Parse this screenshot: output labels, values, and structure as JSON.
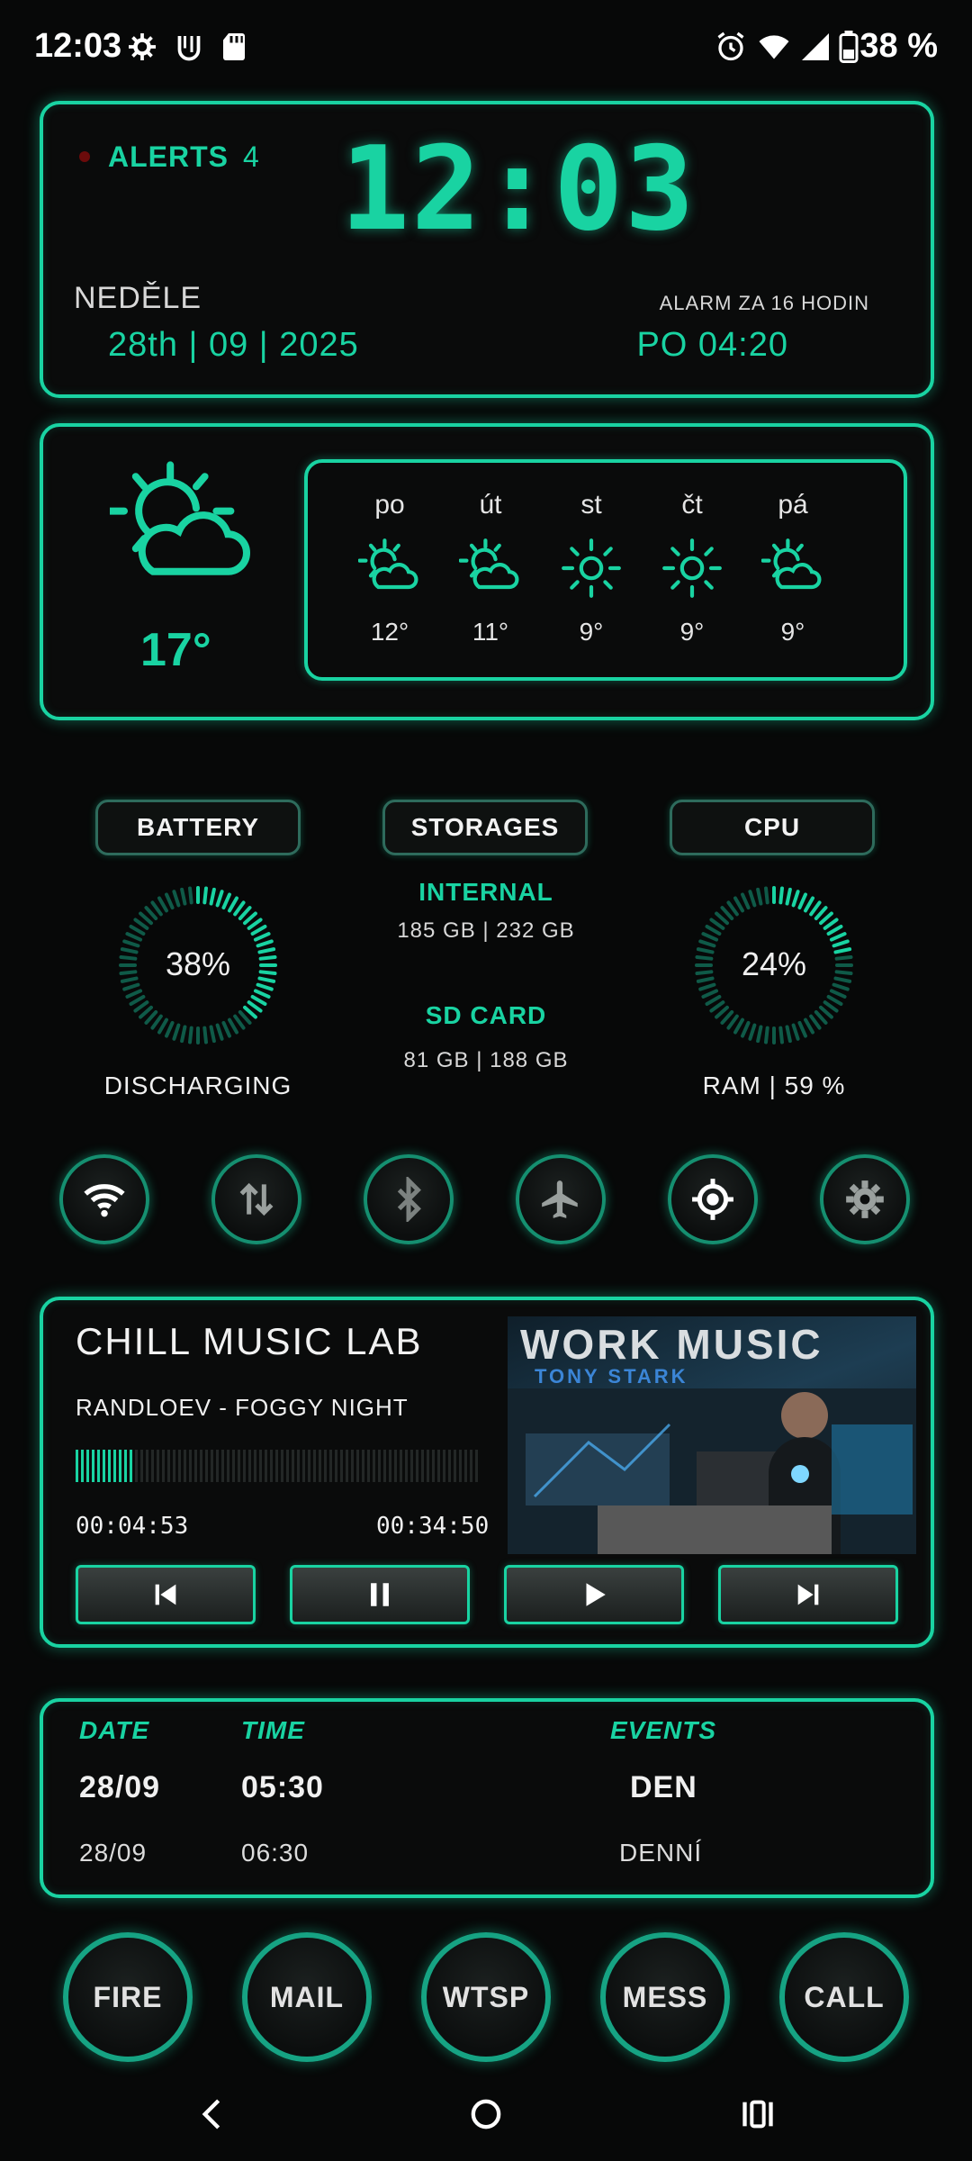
{
  "status_bar": {
    "time": "12:03",
    "battery": "38 %",
    "icons": [
      "gear-sync-icon",
      "u-logo-icon",
      "sd-card-icon",
      "alarm-icon",
      "wifi-icon",
      "signal-icon",
      "battery-icon"
    ]
  },
  "clock_widget": {
    "alerts_label": "ALERTS",
    "alerts_count": "4",
    "time": "12:03",
    "day": "NEDĚLE",
    "date": "28th | 09 | 2025",
    "alarm_label": "ALARM ZA 16 HODIN",
    "alarm_time": "PO 04:20"
  },
  "weather": {
    "current_temp": "17°",
    "current_icon": "sun-cloud-icon",
    "forecast": [
      {
        "day": "po",
        "temp": "12°",
        "icon": "sun-cloud-icon"
      },
      {
        "day": "út",
        "temp": "11°",
        "icon": "sun-cloud-icon"
      },
      {
        "day": "st",
        "temp": "9°",
        "icon": "sun-icon"
      },
      {
        "day": "čt",
        "temp": "9°",
        "icon": "sun-icon"
      },
      {
        "day": "pá",
        "temp": "9°",
        "icon": "sun-cloud-icon"
      }
    ]
  },
  "stats": {
    "battery": {
      "label": "BATTERY",
      "value": "38%",
      "fraction": 0.38,
      "status": "DISCHARGING"
    },
    "storages": {
      "label": "STORAGES",
      "internal_label": "INTERNAL",
      "internal_value": "185 GB | 232 GB",
      "sd_label": "SD CARD",
      "sd_value": "81 GB | 188 GB"
    },
    "cpu": {
      "label": "CPU",
      "value": "24%",
      "fraction": 0.24,
      "ram": "RAM | 59 %"
    }
  },
  "toggles": [
    "wifi-icon",
    "data-transfer-icon",
    "bluetooth-icon",
    "airplane-icon",
    "location-icon",
    "settings-icon"
  ],
  "music": {
    "title": "CHILL MUSIC LAB",
    "track": "RANDLOEV - FOGGY NIGHT",
    "elapsed": "00:04:53",
    "total": "00:34:50",
    "progress": 0.14,
    "album_title": "WORK MUSIC",
    "album_subtitle": "TONY STARK"
  },
  "events": {
    "headers": {
      "date": "DATE",
      "time": "TIME",
      "events": "EVENTS"
    },
    "rows": [
      {
        "date": "28/09",
        "time": "05:30",
        "event": "DEN"
      },
      {
        "date": "28/09",
        "time": "06:30",
        "event": "DENNÍ"
      }
    ]
  },
  "shortcuts": [
    "FIRE",
    "MAIL",
    "WTSP",
    "MESS",
    "CALL"
  ],
  "colors": {
    "accent": "#19d3a2",
    "background": "#070808"
  }
}
